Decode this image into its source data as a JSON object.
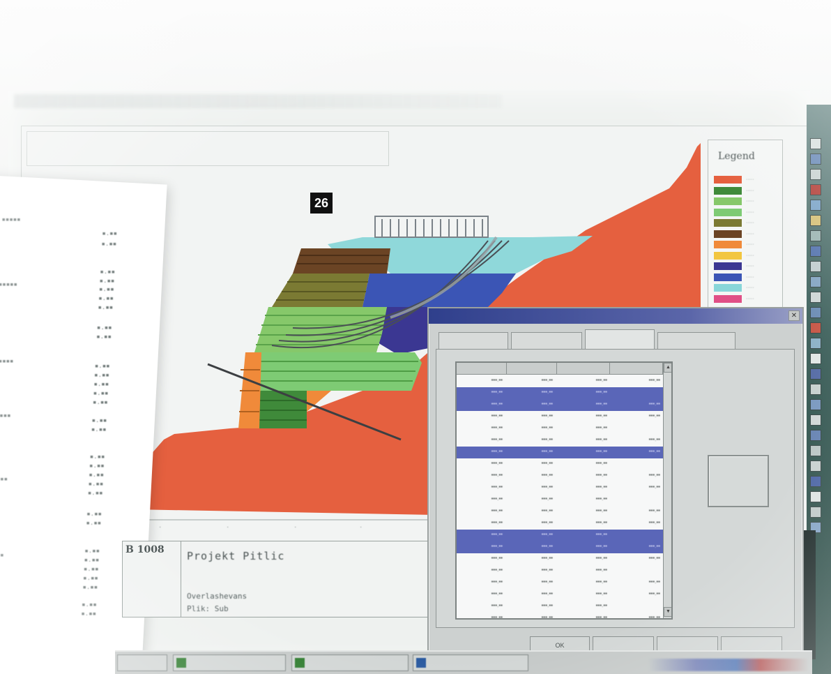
{
  "badge": "26",
  "legend": {
    "title": "Legend",
    "items": [
      {
        "color": "#e5603f"
      },
      {
        "color": "#3f8a3a"
      },
      {
        "color": "#86c86a"
      },
      {
        "color": "#7ecb74"
      },
      {
        "color": "#7b7a33"
      },
      {
        "color": "#6b4424"
      },
      {
        "color": "#f08a3a"
      },
      {
        "color": "#f2c640"
      },
      {
        "color": "#3b3792"
      },
      {
        "color": "#3b55b5"
      },
      {
        "color": "#88d6d9"
      },
      {
        "color": "#e04f86"
      }
    ]
  },
  "info": {
    "id": "B 1008",
    "project": "Projekt Pitlic",
    "line1": "Overlashevans",
    "line2": "Plik: Sub"
  },
  "dialog": {
    "tabs": [
      "",
      "",
      "",
      ""
    ],
    "side_button": "",
    "buttons": [
      "OK",
      "",
      "",
      ""
    ]
  },
  "colors": {
    "soil_red": "#e5603f",
    "cyan": "#8fd8da",
    "blue": "#3b55b5",
    "brown": "#6b4424",
    "olive": "#7b7a33",
    "light_green": "#86c86a",
    "dark_green": "#3f8a3a",
    "orange": "#f08a3a",
    "highlight": "#5a66b8"
  }
}
